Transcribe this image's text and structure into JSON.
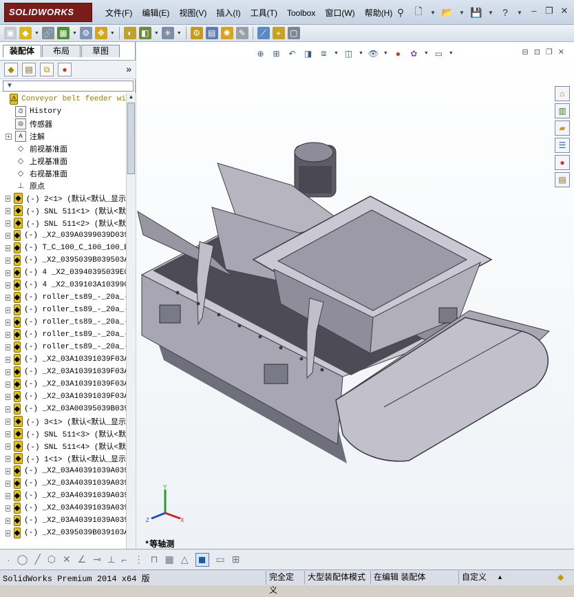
{
  "app": {
    "logo": "SOLIDWORKS",
    "menu": [
      "文件(F)",
      "编辑(E)",
      "视图(V)",
      "插入(I)",
      "工具(T)",
      "Toolbox",
      "窗口(W)",
      "帮助(H)"
    ],
    "title_tools": [
      "pin-icon",
      "new-icon",
      "open-icon",
      "save-icon",
      "help-icon"
    ],
    "window_controls": [
      "minimize-icon",
      "restore-icon",
      "close-icon"
    ]
  },
  "left_panel": {
    "tabs": [
      "装配体",
      "布局",
      "草图"
    ],
    "active_tab": "装配体",
    "fm_tools": [
      "feature-manager-icon",
      "property-manager-icon",
      "configuration-manager-icon",
      "display-manager-icon"
    ],
    "more": "»",
    "filter_symbol": "▼",
    "tree": [
      {
        "label": "Conveyor belt feeder wi",
        "icon": "assembly-warning-icon",
        "expandable": false,
        "root": true
      },
      {
        "label": "History",
        "icon": "history-icon",
        "expandable": false
      },
      {
        "label": "传感器",
        "icon": "sensor-icon",
        "expandable": false
      },
      {
        "label": "注解",
        "icon": "annotation-icon",
        "expandable": true
      },
      {
        "label": "前视基准面",
        "icon": "plane-icon",
        "expandable": false
      },
      {
        "label": "上视基准面",
        "icon": "plane-icon",
        "expandable": false
      },
      {
        "label": "右视基准面",
        "icon": "plane-icon",
        "expandable": false
      },
      {
        "label": "原点",
        "icon": "origin-icon",
        "expandable": false
      },
      {
        "label": "(-) 2<1> (默认<默认_显示",
        "icon": "assembly-icon",
        "expandable": true
      },
      {
        "label": "(-) SNL 511<1> (默认<默",
        "icon": "assembly-icon",
        "expandable": true
      },
      {
        "label": "(-) SNL 511<2> (默认<默",
        "icon": "assembly-icon",
        "expandable": true
      },
      {
        "label": "(-) _X2_039A0399039D039",
        "icon": "assembly-icon",
        "expandable": true
      },
      {
        "label": "(-) T_C_100_C_100_100_B",
        "icon": "assembly-icon",
        "expandable": true
      },
      {
        "label": "(-) _X2_0395039B039503A",
        "icon": "assembly-icon",
        "expandable": true
      },
      {
        "label": "(-) 4 _X2_03940395039E0",
        "icon": "assembly-icon",
        "expandable": true
      },
      {
        "label": "(-) 4 _X2_039103A103990",
        "icon": "assembly-icon",
        "expandable": true
      },
      {
        "label": "(-) roller_ts89_-_20a_-",
        "icon": "assembly-icon",
        "expandable": true
      },
      {
        "label": "(-) roller_ts89_-_20a_-",
        "icon": "assembly-icon",
        "expandable": true
      },
      {
        "label": "(-) roller_ts89_-_20a_-",
        "icon": "assembly-icon",
        "expandable": true
      },
      {
        "label": "(-) roller_ts89_-_20a_-",
        "icon": "assembly-icon",
        "expandable": true
      },
      {
        "label": "(-) roller_ts89_-_20a_-",
        "icon": "assembly-icon",
        "expandable": true
      },
      {
        "label": "(-) _X2_03A10391039F03A",
        "icon": "assembly-icon",
        "expandable": true
      },
      {
        "label": "(-) _X2_03A10391039F03A",
        "icon": "assembly-icon",
        "expandable": true
      },
      {
        "label": "(-) _X2_03A10391039F03A",
        "icon": "assembly-icon",
        "expandable": true
      },
      {
        "label": "(-) _X2_03A10391039F03A",
        "icon": "assembly-icon",
        "expandable": true
      },
      {
        "label": "(-) _X2_03A00395039B039",
        "icon": "assembly-icon",
        "expandable": true
      },
      {
        "label": "(-) 3<1> (默认<默认_显示",
        "icon": "assembly-icon",
        "expandable": true
      },
      {
        "label": "(-) SNL 511<3> (默认<默",
        "icon": "assembly-icon",
        "expandable": true
      },
      {
        "label": "(-) SNL 511<4> (默认<默",
        "icon": "assembly-icon",
        "expandable": true
      },
      {
        "label": "(-) 1<1> (默认<默认_显示",
        "icon": "assembly-icon",
        "expandable": true
      },
      {
        "label": "(-) _X2_03A40391039A039",
        "icon": "assembly-icon",
        "expandable": true
      },
      {
        "label": "(-) _X2_03A40391039A039",
        "icon": "assembly-icon",
        "expandable": true
      },
      {
        "label": "(-) _X2_03A40391039A039",
        "icon": "assembly-icon",
        "expandable": true
      },
      {
        "label": "(-) _X2_03A40391039A039",
        "icon": "assembly-icon",
        "expandable": true
      },
      {
        "label": "(-) _X2_03A40391039A039",
        "icon": "assembly-icon",
        "expandable": true
      },
      {
        "label": "(-) _X2_0395039B039103A",
        "icon": "assembly-icon",
        "expandable": true
      }
    ]
  },
  "viewport": {
    "view_name": "*等轴测",
    "triad": {
      "x": "X",
      "y": "Y",
      "z": "Z"
    },
    "taskpane": [
      "home-icon",
      "resources-icon",
      "design-library-icon",
      "file-explorer-icon",
      "appearances-icon",
      "custom-properties-icon"
    ],
    "colors": {
      "model": "#a7a6b2",
      "model_dark": "#6f6e7b",
      "model_light": "#c9c8d3",
      "belt": "#4d4c56"
    }
  },
  "statusbar": {
    "product": "SolidWorks Premium 2014 x64 版",
    "cells": [
      "完全定义",
      "大型装配体模式",
      "在编辑 装配体",
      "自定义"
    ]
  }
}
